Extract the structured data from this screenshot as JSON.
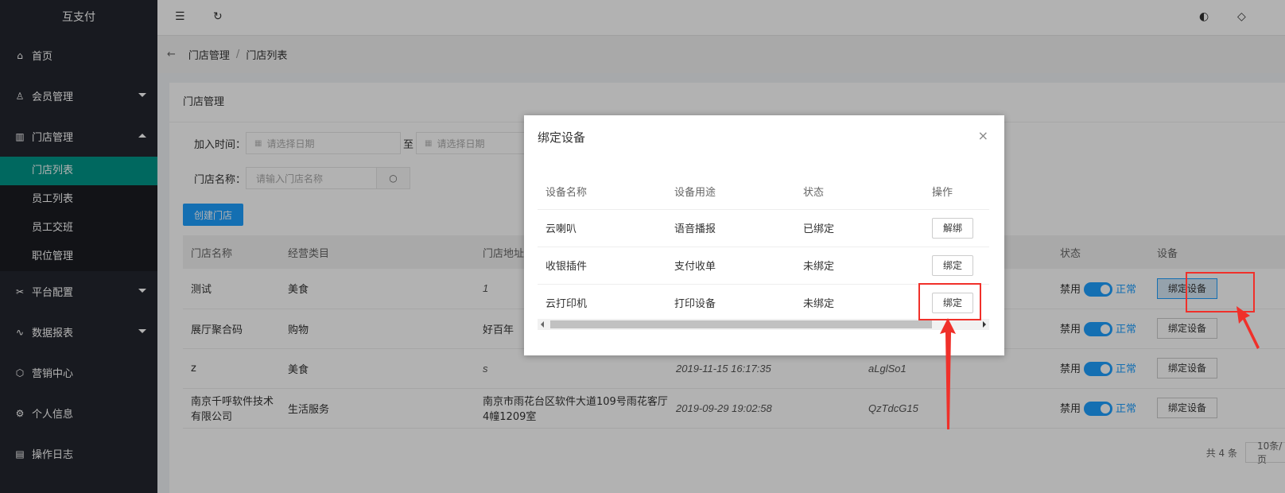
{
  "app": {
    "title": "互支付"
  },
  "sidebar": {
    "items": [
      {
        "label": "首页",
        "icon": "home-icon",
        "glyph": "⌂"
      },
      {
        "label": "会员管理",
        "icon": "user-icon",
        "glyph": "♙",
        "expandable": true
      },
      {
        "label": "门店管理",
        "icon": "store-icon",
        "glyph": "▥",
        "expandable": true,
        "expanded": true
      },
      {
        "label": "平台配置",
        "icon": "tools-icon",
        "glyph": "✂",
        "expandable": true
      },
      {
        "label": "数据报表",
        "icon": "chart-icon",
        "glyph": "∿",
        "expandable": true
      },
      {
        "label": "营销中心",
        "icon": "cube-icon",
        "glyph": "⬡"
      },
      {
        "label": "个人信息",
        "icon": "gear-icon",
        "glyph": "⚙"
      },
      {
        "label": "操作日志",
        "icon": "log-icon",
        "glyph": "▤"
      }
    ],
    "sub_items": [
      "门店列表",
      "员工列表",
      "员工交班",
      "职位管理"
    ],
    "active_sub": "门店列表"
  },
  "header": {
    "menu_icon": "menu-fold-icon",
    "refresh_icon": "refresh-icon",
    "theme_icon": "palette-icon",
    "tag_icon": "tag-icon"
  },
  "breadcrumb": {
    "parent": "门店管理",
    "sep": "/",
    "current": "门店列表"
  },
  "card": {
    "title": "门店管理",
    "filters": {
      "join_time_label": "加入时间：",
      "date_placeholder": "请选择日期",
      "to": "至",
      "name_label": "门店名称：",
      "name_placeholder": "请输入门店名称"
    },
    "create_button": "创建门店",
    "table": {
      "headers": [
        "门店名称",
        "经营类目",
        "门店地址",
        "",
        "",
        "状态",
        "设备"
      ],
      "rows": [
        {
          "name": "测试",
          "category": "美食",
          "address": "1",
          "time": "",
          "code": "",
          "disabled_label": "禁用",
          "status": "正常",
          "action": "绑定设备"
        },
        {
          "name": "展厅聚合码",
          "category": "购物",
          "address": "好百年",
          "time": "",
          "code": "",
          "disabled_label": "禁用",
          "status": "正常",
          "action": "绑定设备"
        },
        {
          "name": "z",
          "category": "美食",
          "address": "s",
          "time": "2019-11-15 16:17:35",
          "code": "aLglSo1",
          "disabled_label": "禁用",
          "status": "正常",
          "action": "绑定设备"
        },
        {
          "name": "南京千呼软件技术有限公司",
          "category": "生活服务",
          "address": "南京市雨花台区软件大道109号雨花客厅4幢1209室",
          "time": "2019-09-29 19:02:58",
          "code": "QzTdcG15",
          "disabled_label": "禁用",
          "status": "正常",
          "action": "绑定设备"
        }
      ]
    },
    "pager": {
      "total": "共 4 条",
      "page_size": "10条/页"
    }
  },
  "modal": {
    "title": "绑定设备",
    "close": "×",
    "headers": [
      "设备名称",
      "设备用途",
      "状态",
      "操作"
    ],
    "rows": [
      {
        "name": "云喇叭",
        "usage": "语音播报",
        "status": "已绑定",
        "action": "解绑"
      },
      {
        "name": "收银插件",
        "usage": "支付收单",
        "status": "未绑定",
        "action": "绑定"
      },
      {
        "name": "云打印机",
        "usage": "打印设备",
        "status": "未绑定",
        "action": "绑定"
      }
    ]
  },
  "colors": {
    "sidebar": "#23262e",
    "active": "#009688",
    "primary": "#1e9fff",
    "annotation": "#f0302a"
  }
}
